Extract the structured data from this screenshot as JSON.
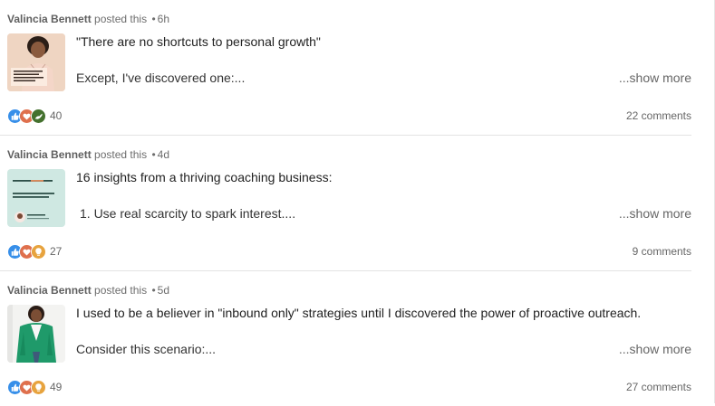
{
  "feed": {
    "posts": [
      {
        "author": "Valincia Bennett",
        "action": "posted this",
        "bullet": "•",
        "age": "6h",
        "line1": "\"There are no shortcuts to personal growth\"",
        "line2": "Except, I've discovered one:...",
        "show_more": "...show more",
        "reaction_count": "40",
        "comments": "22 comments",
        "thumb_caption": "Getting to the next level in business is about learning how to make hard decisions..."
      },
      {
        "author": "Valincia Bennett",
        "action": "posted this",
        "bullet": "•",
        "age": "4d",
        "line1": "16 insights from a thriving coaching business:",
        "line2": "1. Use real scarcity to spark interest....",
        "show_more": "...show more",
        "reaction_count": "27",
        "comments": "9 comments",
        "thumb_heading": "Stop prospecting, start qualifying.",
        "thumb_body": "When you're always ready, you never have to go asking."
      },
      {
        "author": "Valincia Bennett",
        "action": "posted this",
        "bullet": "•",
        "age": "5d",
        "line1": "I used to be a believer in \"inbound only\" strategies until I discovered the power of proactive outreach.",
        "line2": "Consider this scenario:...",
        "show_more": "...show more",
        "reaction_count": "49",
        "comments": "27 comments"
      }
    ]
  },
  "colors": {
    "like_blue": "#378fe9",
    "love_red": "#df704d",
    "support_green": "#44712e",
    "insightful_gold": "#e7a33e",
    "text_muted": "#666666"
  },
  "icons": {
    "reactions_post1": [
      "like-icon",
      "love-icon",
      "support-icon"
    ],
    "reactions_post2": [
      "like-icon",
      "love-icon",
      "insightful-icon"
    ],
    "reactions_post3": [
      "like-icon",
      "love-icon",
      "insightful-icon"
    ]
  }
}
